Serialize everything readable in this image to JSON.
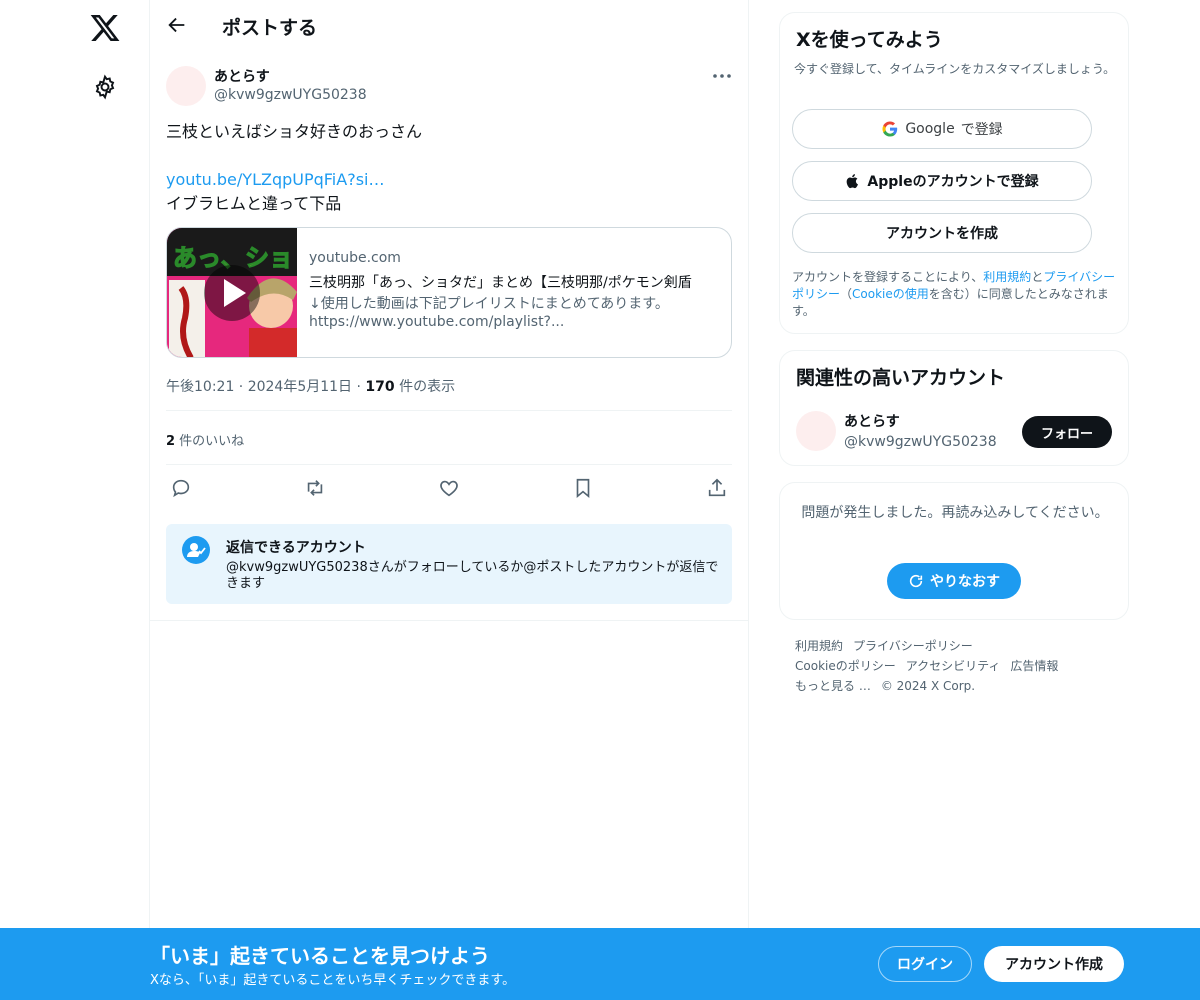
{
  "colors": {
    "accent": "#1d9bf0",
    "text": "#0f1419",
    "muted": "#536471",
    "border": "#eff3f4"
  },
  "nav": {
    "logo_icon": "x-logo-icon",
    "settings_icon": "gear-icon"
  },
  "header": {
    "title": "ポストする",
    "back_icon": "arrow-left-icon"
  },
  "post": {
    "author_name": "あとらす",
    "author_handle": "@kvw9gzwUYG50238",
    "text_line1": "三枝といえばショタ好きのおっさん",
    "link_text": "youtu.be/YLZqpUPqFiA?si…",
    "text_line3": "イブラヒムと違って下品",
    "card": {
      "domain": "youtube.com",
      "title": "三枝明那「あっ、ショタだ」まとめ【三枝明那/ポケモン剣盾",
      "description_line1": "↓使用した動画は下記プレイリストにまとめてあります。",
      "description_line2": "https://www.youtube.com/playlist?...",
      "thumb_text": "あっ、ショ"
    },
    "timestamp": "午後10:21 · 2024年5月11日 · ",
    "views_count": "170",
    "views_label": " 件の表示",
    "likes_count": "2",
    "likes_label": " 件のいいね",
    "actions": [
      "reply-icon",
      "repost-icon",
      "like-icon",
      "bookmark-icon",
      "share-icon"
    ],
    "reply_restriction": {
      "title": "返信できるアカウント",
      "description": "@kvw9gzwUYG50238さんがフォローしているか@ポストしたアカウントが返信できます"
    }
  },
  "signup_panel": {
    "title": "Xを使ってみよう",
    "subtitle": "今すぐ登録して、タイムラインをカスタマイズしましょう。",
    "google_brand": "Google",
    "google_suffix": " で登録",
    "apple_label": "Appleのアカウントで登録",
    "create_label": "アカウントを作成",
    "legal_prefix": "アカウントを登録することにより、",
    "legal_terms": "利用規約",
    "legal_and": "と",
    "legal_privacy": "プライバシーポリシー",
    "legal_paren_open": "（",
    "legal_cookie": "Cookieの使用",
    "legal_suffix": "を含む）に同意したとみなされます。"
  },
  "relevant_panel": {
    "title": "関連性の高いアカウント",
    "name": "あとらす",
    "handle": "@kvw9gzwUYG50238",
    "follow_label": "フォロー"
  },
  "error_panel": {
    "message": "問題が発生しました。再読み込みしてください。",
    "retry_label": "やりなおす"
  },
  "footer": {
    "links": [
      "利用規約",
      "プライバシーポリシー",
      "Cookieのポリシー",
      "アクセシビリティ",
      "広告情報",
      "もっと見る …",
      "© 2024 X Corp."
    ]
  },
  "banner": {
    "title": "「いま」起きていることを見つけよう",
    "subtitle": "Xなら、「いま」起きていることをいち早くチェックできます。",
    "login_label": "ログイン",
    "signup_label": "アカウント作成"
  }
}
